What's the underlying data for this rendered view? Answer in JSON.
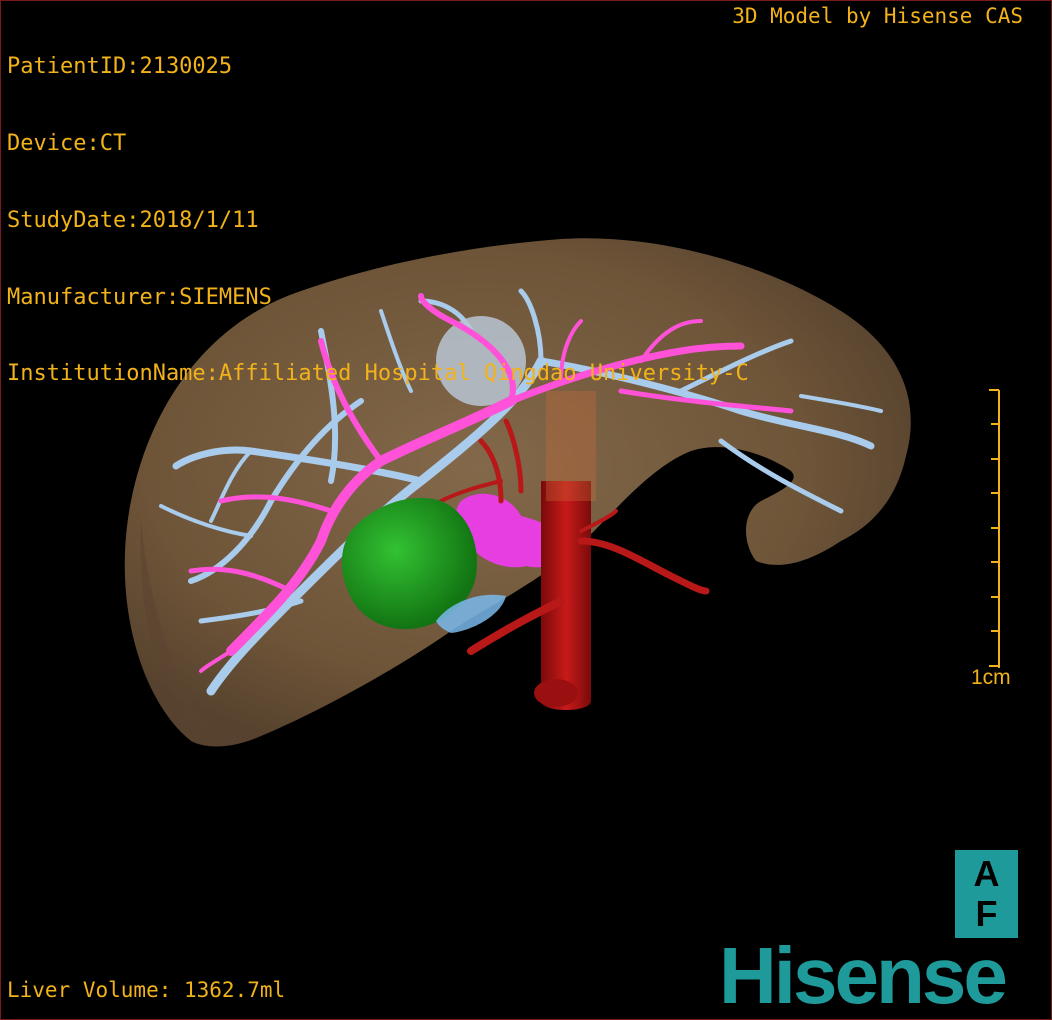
{
  "header": {
    "patient_id": "PatientID:2130025",
    "device": "Device:CT",
    "study_date": "StudyDate:2018/1/11",
    "manufacturer": "Manufacturer:SIEMENS",
    "institution": "InstitutionName:Affiliated Hospital Qingdao University-C"
  },
  "brand_text": "3D Model by Hisense CAS",
  "footer": {
    "liver_volume": "Liver Volume: 1362.7ml"
  },
  "scale_bar": {
    "label": "1cm"
  },
  "orientation": {
    "top": "A",
    "bottom": "F"
  },
  "logo": "Hisense",
  "colors": {
    "text": "#f2b21a",
    "liver": "#8a6a48",
    "portal_vein": "#ff4fd8",
    "hepatic_vein": "#9ec4e8",
    "artery": "#b01010",
    "tumor": "#1f9a1f",
    "logo": "#1f9a9a"
  }
}
